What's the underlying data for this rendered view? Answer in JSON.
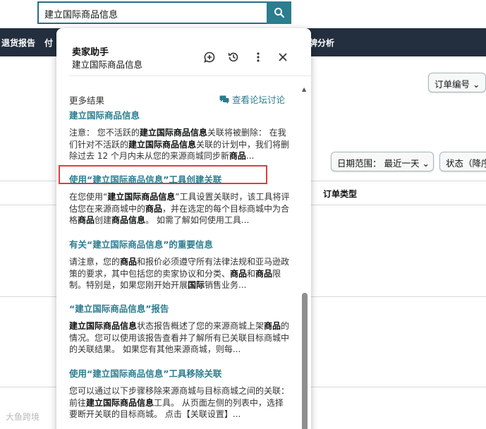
{
  "search": {
    "value": "建立国际商品信息"
  },
  "nav": {
    "items": [
      "退货报告",
      "付",
      "牌分析"
    ]
  },
  "background": {
    "order_number_select": "订单编号",
    "date_range_select": "日期范围：  最近一天",
    "status_select": "状态（降序",
    "order_type_header": "订单类型",
    "watermark": "大鱼跨境"
  },
  "panel": {
    "title": "卖家助手",
    "subtitle": "建立国际商品信息",
    "section_label": "更多结果",
    "forum_link": "查看论坛讨论",
    "icons": [
      "add-chat-icon",
      "history-icon",
      "more-vertical-icon",
      "close-icon"
    ]
  },
  "results": [
    {
      "title": "建立国际商品信息",
      "segments": [
        {
          "t": "注意： 您不活跃的",
          "b": false
        },
        {
          "t": "建立国际商品信息",
          "b": true
        },
        {
          "t": "关联将被删除： 在我们针对不活跃的",
          "b": false
        },
        {
          "t": "建立国际商品信息",
          "b": true
        },
        {
          "t": "关联的计划中，我们将删除过去 12 个月内未从您的来源商城同步新",
          "b": false
        },
        {
          "t": "商品",
          "b": true
        },
        {
          "t": "...",
          "b": false
        }
      ]
    },
    {
      "title": "使用“建立国际商品信息”工具创建关联",
      "segments": [
        {
          "t": "在您使用“",
          "b": false
        },
        {
          "t": "建立国际商品信息",
          "b": true
        },
        {
          "t": "”工具设置关联时，该工具将评估您在来源商城中的",
          "b": false
        },
        {
          "t": "商品",
          "b": true
        },
        {
          "t": "，并在选定的每个目标商城中为合格",
          "b": false
        },
        {
          "t": "商品",
          "b": true
        },
        {
          "t": "创建",
          "b": false
        },
        {
          "t": "商品信息",
          "b": true
        },
        {
          "t": "。 如需了解如何使用工具...",
          "b": false
        }
      ]
    },
    {
      "title": "有关“建立国际商品信息”的重要信息",
      "segments": [
        {
          "t": "请注意，您的",
          "b": false
        },
        {
          "t": "商品",
          "b": true
        },
        {
          "t": "和报价必须遵守所有法律法规和亚马逊政策的要求，其中包括您的卖家协议和分类、",
          "b": false
        },
        {
          "t": "商品",
          "b": true
        },
        {
          "t": "和",
          "b": false
        },
        {
          "t": "商品",
          "b": true
        },
        {
          "t": "限制。特别是，如果您刚开始开展",
          "b": false
        },
        {
          "t": "国际",
          "b": true
        },
        {
          "t": "销售业务...",
          "b": false
        }
      ]
    },
    {
      "title": "“建立国际商品信息”报告",
      "segments": [
        {
          "t": "建立国际商品信息",
          "b": true
        },
        {
          "t": "状态报告概述了您的来源商城上架",
          "b": false
        },
        {
          "t": "商品",
          "b": true
        },
        {
          "t": "的情况。您可以使用该报告查看并了解所有已关联目标商城中的关联结果。 如果您有其他来源商城，则每...",
          "b": false
        }
      ]
    },
    {
      "title": "使用“建立国际商品信息”工具移除关联",
      "segments": [
        {
          "t": "您可以通过以下步骤移除来源商城与目标商城之间的关联： 前往",
          "b": false
        },
        {
          "t": "建立国际商品信息",
          "b": true
        },
        {
          "t": "工具。 从页面左侧的列表中，选择要断开关联的目标商城。 点击【关联设置】...",
          "b": false
        }
      ]
    }
  ],
  "colors": {
    "accent": "#2b7d8f",
    "navbar": "#232f3e",
    "highlight": "#e03d3d"
  }
}
